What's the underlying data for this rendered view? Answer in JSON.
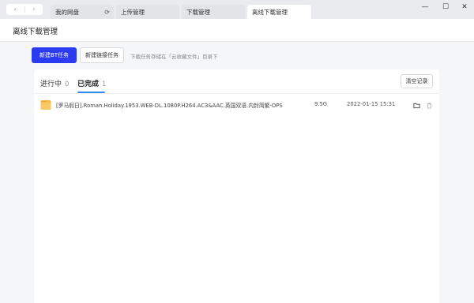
{
  "titlebar": {
    "tabs": [
      {
        "label": "我的网盘"
      },
      {
        "label": "上传管理"
      },
      {
        "label": "下载管理"
      },
      {
        "label": "离线下载管理"
      }
    ],
    "window_controls": {
      "minimize": "—",
      "maximize": "☐",
      "close": "✕"
    }
  },
  "page": {
    "title": "离线下载管理"
  },
  "toolbar": {
    "new_bt_label": "新建BT任务",
    "new_link_label": "新建链接任务",
    "hint": "下载任务存储在「云收藏文件」目录下"
  },
  "status_tabs": [
    {
      "label": "进行中",
      "count": "0"
    },
    {
      "label": "已完成",
      "count": "1"
    }
  ],
  "clear_label": "清空记录",
  "files": [
    {
      "name": "[罗马假日].Roman.Holiday.1953.WEB-DL.1080P.H264.AC3&AAC.英国双语.内封简繁-OPS",
      "size": "9.5G",
      "date": "2022-01-15 15:31"
    }
  ],
  "colors": {
    "primary": "#2a3bf0",
    "accent": "#2a8cf0",
    "folder": "#f5b94a"
  },
  "icons": [
    "back-arrow-icon",
    "forward-arrow-icon",
    "refresh-icon",
    "folder-icon",
    "open-folder-icon",
    "trash-icon"
  ]
}
